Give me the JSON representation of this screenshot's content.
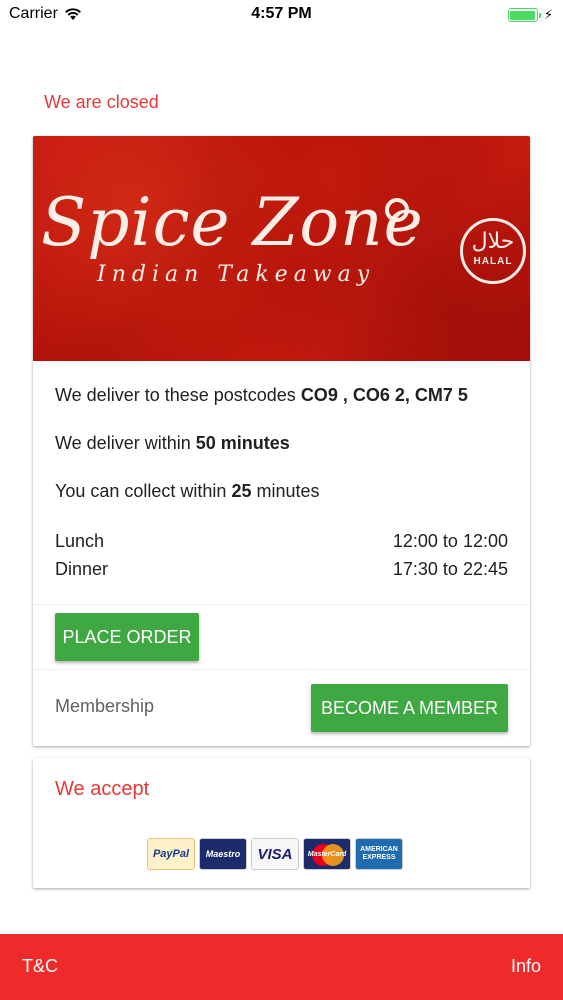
{
  "status_bar": {
    "carrier": "Carrier",
    "time": "4:57 PM",
    "icons": [
      "wifi-icon",
      "battery-icon",
      "charging-bolt-icon"
    ]
  },
  "closed_message": "We are closed",
  "banner": {
    "title": "Spice Zone",
    "subtitle": "Indian Takeaway",
    "badge_arabic": "حلال",
    "badge_label": "HALAL"
  },
  "info": {
    "postcodes_prefix": "We deliver to these postcodes ",
    "postcodes": "CO9 , CO6 2, CM7 5",
    "delivery_prefix": "We deliver within ",
    "delivery_time": "50 minutes",
    "collect_prefix": "You can collect within ",
    "collect_value": "25",
    "collect_suffix": " minutes",
    "hours": [
      {
        "name": "Lunch",
        "time": "12:00 to 12:00"
      },
      {
        "name": "Dinner",
        "time": "17:30 to 22:45"
      }
    ]
  },
  "buttons": {
    "place_order": "PLACE ORDER",
    "membership_label": "Membership",
    "become_member": "BECOME A MEMBER"
  },
  "accept": {
    "title": "We accept",
    "methods": {
      "paypal": "PayPal",
      "maestro": "Maestro",
      "visa": "VISA",
      "mastercard": "MasterCard",
      "amex": "AMERICAN EXPRESS"
    }
  },
  "footer": {
    "left": "T&C",
    "right": "Info"
  },
  "colors": {
    "accent_red": "#e53935",
    "button_green": "#3fa843",
    "footer_red": "#ee2a2a",
    "battery_green": "#4cd964"
  }
}
